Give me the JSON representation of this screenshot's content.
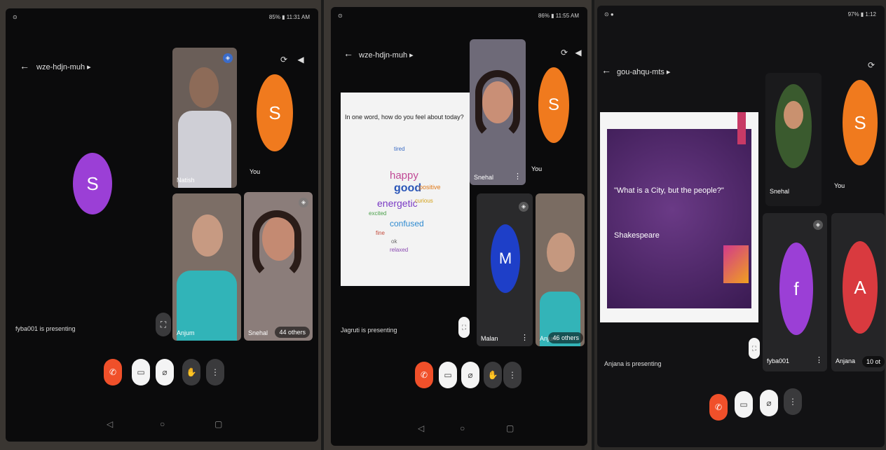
{
  "panels": [
    {
      "status_right": "85% ▮ 11:31 AM",
      "status_left": "⊙",
      "meeting_code": "wze-hdjn-muh ▸",
      "main_avatar_letter": "S",
      "tile_names": [
        "Natish",
        "Anjum",
        "Snehal"
      ],
      "self_avatar_letter": "S",
      "self_label": "You",
      "others_label": "44 others",
      "presenting_text": "fyba001 is presenting"
    },
    {
      "status_right": "86% ▮ 11:55 AM",
      "status_left": "⊙",
      "meeting_code": "wze-hdjn-muh ▸",
      "slide_question": "In one word, how do you feel about today?",
      "slide_words": [
        "happy",
        "good",
        "energetic",
        "confused",
        "positive",
        "curious",
        "excited",
        "fine",
        "ok",
        "tired",
        "relaxed"
      ],
      "tile_names": [
        "Snehal",
        "You",
        "Malan",
        "Anjum"
      ],
      "self_avatar_letter": "S",
      "m_avatar_letter": "M",
      "others_label": "46 others",
      "presenting_text": "Jagruti is presenting"
    },
    {
      "status_right": "97% ▮ 1:12",
      "status_left": "⊙ ●",
      "meeting_code": "gou-ahqu-mts ▸",
      "slide_quote": "\"What is a City, but the people?\"",
      "slide_author": "Shakespeare",
      "tile_names": [
        "Snehal",
        "You",
        "fyba001",
        "Anjana"
      ],
      "self_avatar_letter": "S",
      "f_avatar_letter": "f",
      "a_avatar_letter": "A",
      "others_label": "10 ot",
      "presenting_text": "Anjana is presenting"
    }
  ],
  "colors": {
    "end_call": "#f0502a",
    "avatar_orange": "#f07a1e",
    "avatar_purple": "#9b3fd6",
    "avatar_blue": "#1e3fc8",
    "avatar_red": "#d93a3f",
    "slide_purple": "#4a2260"
  },
  "icons": [
    "back-arrow-icon",
    "camera-switch-icon",
    "speaker-icon",
    "end-call-icon",
    "camera-off-icon",
    "mic-off-icon",
    "raise-hand-icon",
    "more-options-icon",
    "pin-icon",
    "back-nav-icon",
    "home-nav-icon",
    "recents-nav-icon"
  ]
}
